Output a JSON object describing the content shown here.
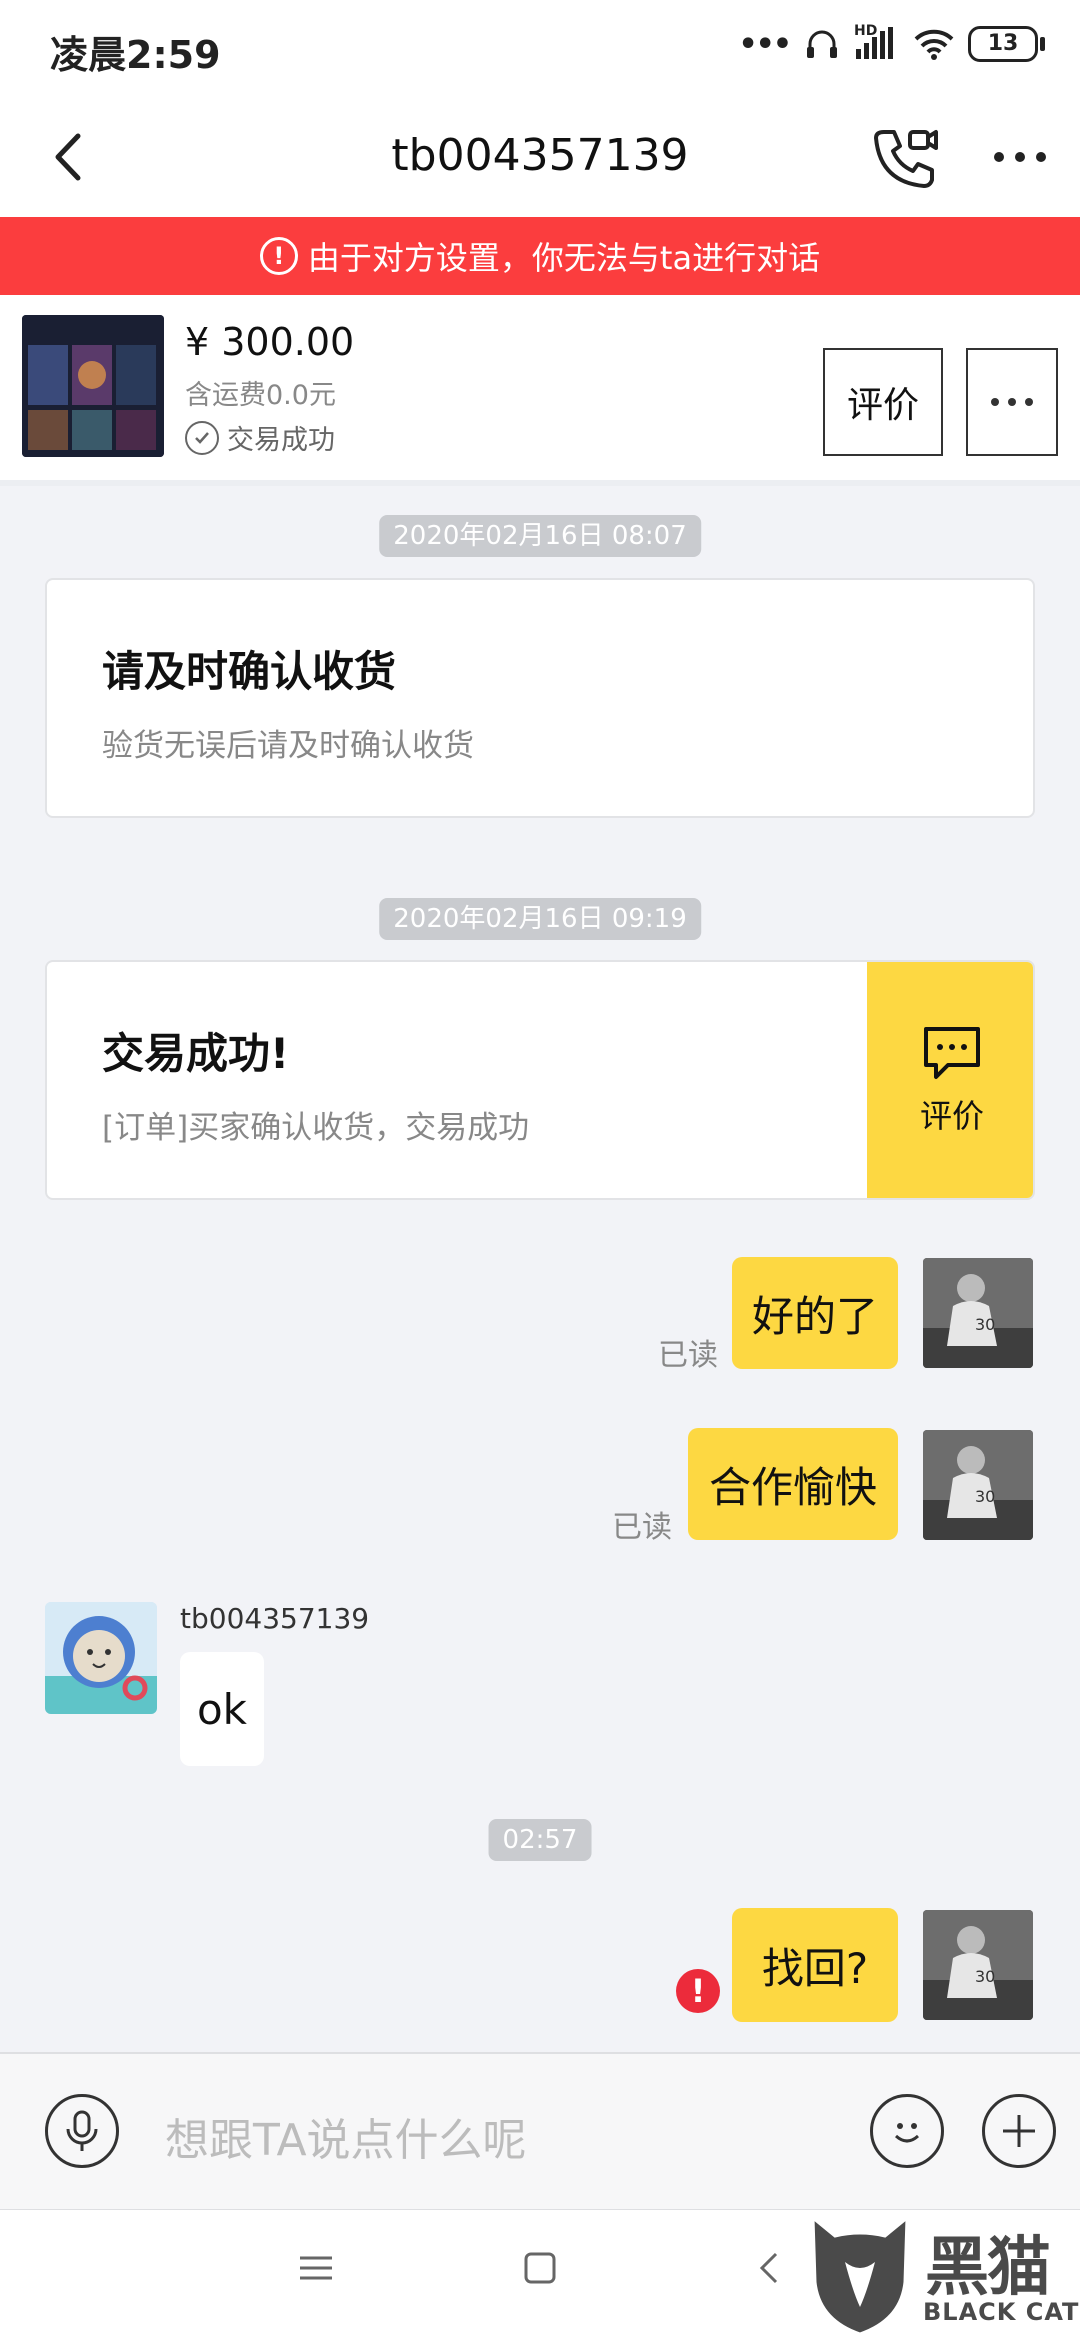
{
  "status": {
    "time": "凌晨2:59",
    "battery": "13",
    "network": "HD"
  },
  "header": {
    "title": "tb004357139"
  },
  "banner": {
    "text": "由于对方设置，你无法与ta进行对话"
  },
  "product": {
    "price": "¥ 300.00",
    "shipping": "含运费0.0元",
    "status": "交易成功",
    "rate_label": "评价"
  },
  "chat": {
    "time1": "2020年02月16日 08:07",
    "card1": {
      "title": "请及时确认收货",
      "subtitle": "验货无误后请及时确认收货"
    },
    "time2": "2020年02月16日 09:19",
    "card2": {
      "title": "交易成功!",
      "subtitle": "[订单]买家确认收货，交易成功",
      "action": "评价"
    },
    "msg1": {
      "text": "好的了",
      "status": "已读"
    },
    "msg2": {
      "text": "合作愉快",
      "status": "已读"
    },
    "other": {
      "name": "tb004357139",
      "text": "ok"
    },
    "time3": "02:57",
    "msg3": {
      "text": "找回?"
    }
  },
  "input": {
    "placeholder": "想跟TA说点什么呢"
  },
  "watermark": {
    "brand": "黑猫",
    "sub": "BLACK CAT"
  },
  "colors": {
    "accent_yellow": "#fdd842",
    "banner_red": "#fb3d3e",
    "error_red": "#ec2b3b"
  }
}
